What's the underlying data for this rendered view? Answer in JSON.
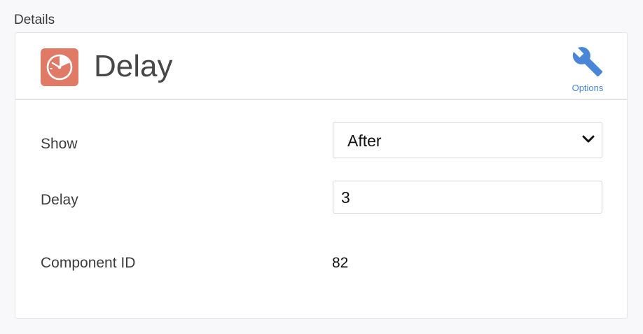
{
  "section": {
    "label": "Details"
  },
  "component": {
    "title": "Delay",
    "icon": "delay-timer-icon",
    "icon_color": "#e07a67"
  },
  "header": {
    "options_label": "Options",
    "options_icon": "wrench-icon",
    "accent_color": "#4a86d8"
  },
  "form": {
    "show": {
      "label": "Show",
      "selected": "After"
    },
    "delay": {
      "label": "Delay",
      "value": "3"
    },
    "component_id": {
      "label": "Component ID",
      "value": "82"
    }
  }
}
